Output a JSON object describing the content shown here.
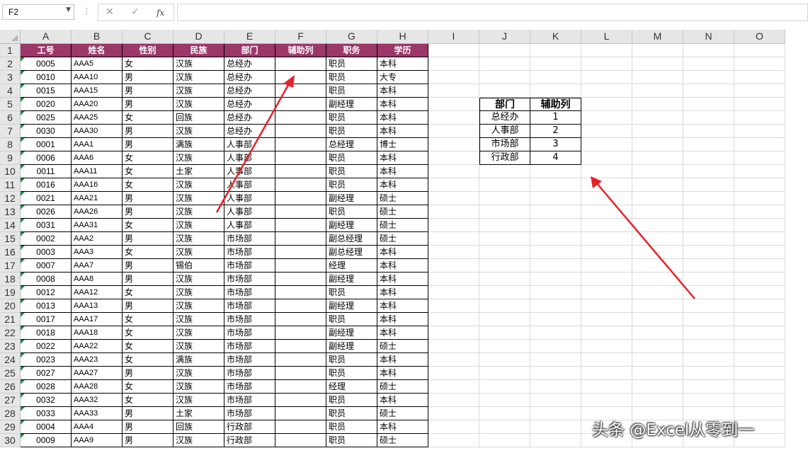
{
  "formula_bar": {
    "name_box": "F2",
    "name_box_dropdown_icon": "chevron-down-icon",
    "cancel_icon": "✕",
    "enter_icon": "✓",
    "fx_label": "fx",
    "formula_value": ""
  },
  "columns": [
    "A",
    "B",
    "C",
    "D",
    "E",
    "F",
    "G",
    "H",
    "I",
    "J",
    "K",
    "L",
    "M",
    "N",
    "O"
  ],
  "rows": [
    "1",
    "2",
    "3",
    "4",
    "5",
    "6",
    "7",
    "8",
    "9",
    "10",
    "11",
    "12",
    "13",
    "14",
    "15",
    "16",
    "17",
    "18",
    "19",
    "20",
    "21",
    "22",
    "23",
    "24",
    "25",
    "26",
    "27",
    "28",
    "29",
    "30"
  ],
  "table": {
    "headers": [
      "工号",
      "姓名",
      "性别",
      "民族",
      "部门",
      "辅助列",
      "职务",
      "学历"
    ],
    "header_color": "#9b3769",
    "records": [
      [
        "0005",
        "AAA5",
        "女",
        "汉族",
        "总经办",
        "",
        "职员",
        "本科"
      ],
      [
        "0010",
        "AAA10",
        "男",
        "汉族",
        "总经办",
        "",
        "职员",
        "大专"
      ],
      [
        "0015",
        "AAA15",
        "男",
        "汉族",
        "总经办",
        "",
        "职员",
        "本科"
      ],
      [
        "0020",
        "AAA20",
        "男",
        "汉族",
        "总经办",
        "",
        "副经理",
        "本科"
      ],
      [
        "0025",
        "AAA25",
        "女",
        "回族",
        "总经办",
        "",
        "职员",
        "本科"
      ],
      [
        "0030",
        "AAA30",
        "男",
        "汉族",
        "总经办",
        "",
        "职员",
        "本科"
      ],
      [
        "0001",
        "AAA1",
        "男",
        "满族",
        "人事部",
        "",
        "总经理",
        "博士"
      ],
      [
        "0006",
        "AAA6",
        "女",
        "汉族",
        "人事部",
        "",
        "职员",
        "本科"
      ],
      [
        "0011",
        "AAA11",
        "女",
        "土家",
        "人事部",
        "",
        "职员",
        "本科"
      ],
      [
        "0016",
        "AAA16",
        "女",
        "汉族",
        "人事部",
        "",
        "职员",
        "本科"
      ],
      [
        "0021",
        "AAA21",
        "男",
        "汉族",
        "人事部",
        "",
        "副经理",
        "硕士"
      ],
      [
        "0026",
        "AAA26",
        "男",
        "汉族",
        "人事部",
        "",
        "职员",
        "硕士"
      ],
      [
        "0031",
        "AAA31",
        "女",
        "汉族",
        "人事部",
        "",
        "副经理",
        "硕士"
      ],
      [
        "0002",
        "AAA2",
        "男",
        "汉族",
        "市场部",
        "",
        "副总经理",
        "硕士"
      ],
      [
        "0003",
        "AAA3",
        "女",
        "汉族",
        "市场部",
        "",
        "副总经理",
        "本科"
      ],
      [
        "0007",
        "AAA7",
        "男",
        "锡伯",
        "市场部",
        "",
        "经理",
        "本科"
      ],
      [
        "0008",
        "AAA8",
        "男",
        "汉族",
        "市场部",
        "",
        "副经理",
        "本科"
      ],
      [
        "0012",
        "AAA12",
        "女",
        "汉族",
        "市场部",
        "",
        "职员",
        "本科"
      ],
      [
        "0013",
        "AAA13",
        "男",
        "汉族",
        "市场部",
        "",
        "副经理",
        "本科"
      ],
      [
        "0017",
        "AAA17",
        "女",
        "汉族",
        "市场部",
        "",
        "职员",
        "本科"
      ],
      [
        "0018",
        "AAA18",
        "女",
        "汉族",
        "市场部",
        "",
        "副经理",
        "本科"
      ],
      [
        "0022",
        "AAA22",
        "女",
        "汉族",
        "市场部",
        "",
        "副经理",
        "硕士"
      ],
      [
        "0023",
        "AAA23",
        "女",
        "满族",
        "市场部",
        "",
        "职员",
        "本科"
      ],
      [
        "0027",
        "AAA27",
        "男",
        "汉族",
        "市场部",
        "",
        "职员",
        "本科"
      ],
      [
        "0028",
        "AAA28",
        "女",
        "汉族",
        "市场部",
        "",
        "经理",
        "硕士"
      ],
      [
        "0032",
        "AAA32",
        "女",
        "汉族",
        "市场部",
        "",
        "职员",
        "本科"
      ],
      [
        "0033",
        "AAA33",
        "男",
        "土家",
        "市场部",
        "",
        "职员",
        "硕士"
      ],
      [
        "0004",
        "AAA4",
        "男",
        "回族",
        "行政部",
        "",
        "职员",
        "本科"
      ],
      [
        "0009",
        "AAA9",
        "男",
        "汉族",
        "行政部",
        "",
        "职员",
        "硕士"
      ]
    ]
  },
  "lookup": {
    "headers": [
      "部门",
      "辅助列"
    ],
    "rows": [
      [
        "总经办",
        "1"
      ],
      [
        "人事部",
        "2"
      ],
      [
        "市场部",
        "3"
      ],
      [
        "行政部",
        "4"
      ]
    ]
  },
  "annotation_color": "#e8202a",
  "watermark": "头条 @Excel从零到一"
}
